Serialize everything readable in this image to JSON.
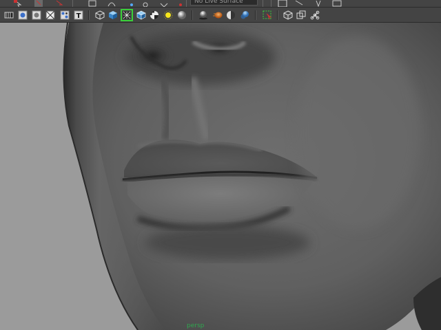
{
  "status_line": {
    "object_field_value": "No Live Surface"
  },
  "panel_toolbar": {
    "buttons": [
      {
        "name": "camera-attributes",
        "icon": "film-gate-icon"
      },
      {
        "name": "image-plane",
        "icon": "image-plane-icon"
      },
      {
        "name": "two-d-pan-zoom",
        "icon": "pan-zoom-icon"
      },
      {
        "name": "grease-pencil",
        "icon": "grid-icon"
      },
      {
        "name": "grid-toggle",
        "icon": "grid-pattern-icon"
      },
      {
        "name": "heads-up-display",
        "icon": "hud-icon"
      },
      {
        "name": "text",
        "icon": "text-icon"
      },
      {
        "name": "wireframe",
        "icon": "wireframe-cube-icon"
      },
      {
        "name": "smooth-shade",
        "icon": "shaded-cube-icon"
      },
      {
        "name": "wireframe-on-shaded",
        "icon": "wire-on-shaded-icon",
        "active": true
      },
      {
        "name": "textured",
        "icon": "textured-icon"
      },
      {
        "name": "use-default-material",
        "icon": "checker-icon"
      },
      {
        "name": "use-all-lights",
        "icon": "sphere-icon"
      },
      {
        "name": "shadows",
        "icon": "light-bulb-icon"
      },
      {
        "name": "screen-space-ao",
        "icon": "ao-sphere-icon"
      },
      {
        "name": "motion-blur",
        "icon": "motion-blur-icon"
      },
      {
        "name": "multisample-aa",
        "icon": "half-sphere-icon"
      },
      {
        "name": "depth-of-field",
        "icon": "dof-icon"
      },
      {
        "name": "isolate-select",
        "icon": "isolate-icon"
      },
      {
        "name": "xray",
        "icon": "xray-cube-icon"
      },
      {
        "name": "xray-active-components",
        "icon": "xray-components-icon"
      },
      {
        "name": "xray-joints",
        "icon": "joints-icon"
      }
    ]
  },
  "viewport": {
    "camera_label": "persp",
    "background_color": "#9b9b9b",
    "label_color": "#2fa84f",
    "active_outline_color": "#3ad03a"
  }
}
